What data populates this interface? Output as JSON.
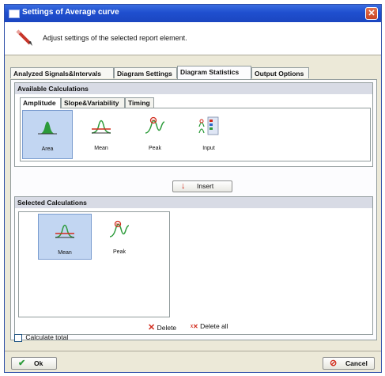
{
  "window": {
    "title": "Settings of Average curve",
    "close_symbol": "✕"
  },
  "info": {
    "message": "Adjust settings of the selected report element."
  },
  "tabs": [
    {
      "label": "Analyzed Signals&Intervals"
    },
    {
      "label": "Diagram Settings"
    },
    {
      "label": "Diagram Statistics"
    },
    {
      "label": "Output Options"
    }
  ],
  "available": {
    "title": "Available Calculations",
    "subtabs": [
      {
        "label": "Amplitude"
      },
      {
        "label": "Slope&Variability"
      },
      {
        "label": "Timing"
      }
    ],
    "items": [
      {
        "label": "Area",
        "icon": "area-icon",
        "selected": true
      },
      {
        "label": "Mean",
        "icon": "mean-icon",
        "selected": false
      },
      {
        "label": "Peak",
        "icon": "peak-icon",
        "selected": false
      },
      {
        "label": "Input",
        "icon": "input-icon",
        "selected": false
      }
    ]
  },
  "insert_button": {
    "label": "Insert",
    "icon": "insert-arrow-icon"
  },
  "selected": {
    "title": "Selected Calculations",
    "items": [
      {
        "label": "Mean",
        "icon": "mean-icon",
        "selected": true
      },
      {
        "label": "Peak",
        "icon": "peak-icon",
        "selected": false
      }
    ]
  },
  "delete_button": {
    "label": "Delete"
  },
  "delete_all_button": {
    "label": "Delete all"
  },
  "calculate_total": {
    "label": "Calculate total",
    "checked": false
  },
  "footer": {
    "ok_label": "Ok",
    "cancel_label": "Cancel"
  },
  "colors": {
    "titlebar": "#1f4fcf",
    "selection": "#c2d6f2",
    "group_header": "#d8dbe5",
    "green": "#2c9b3a",
    "red": "#d12b1c"
  }
}
